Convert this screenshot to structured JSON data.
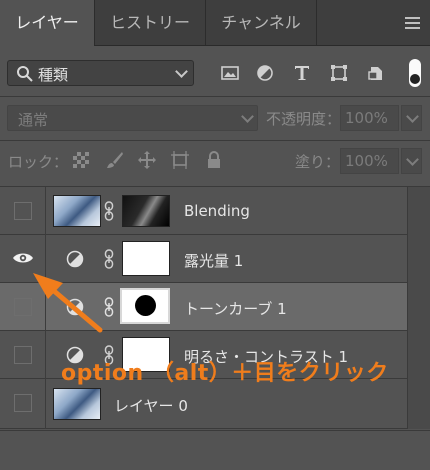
{
  "tabs": [
    {
      "label": "レイヤー",
      "active": true
    },
    {
      "label": "ヒストリー",
      "active": false
    },
    {
      "label": "チャンネル",
      "active": false
    }
  ],
  "filter": {
    "label": "種類"
  },
  "blend_mode": {
    "label": "通常"
  },
  "opacity": {
    "label": "不透明度：",
    "value": "100%"
  },
  "lock": {
    "label": "ロック："
  },
  "fill": {
    "label": "塗り：",
    "value": "100%"
  },
  "layers": [
    {
      "name": "Blending",
      "visible": false,
      "selected": false
    },
    {
      "name": "露光量 1",
      "visible": true,
      "selected": false
    },
    {
      "name": "トーンカーブ 1",
      "visible": false,
      "selected": true
    },
    {
      "name": "明るさ・コントラスト 1",
      "visible": false,
      "selected": false
    },
    {
      "name": "レイヤー 0",
      "visible": false,
      "selected": false
    }
  ],
  "annotation": {
    "text": "option （alt）＋目をクリック",
    "color": "#f07d1c"
  },
  "colors": {
    "panel": "#535353",
    "selected_row": "#6a6a6a",
    "accent": "#f07d1c"
  }
}
